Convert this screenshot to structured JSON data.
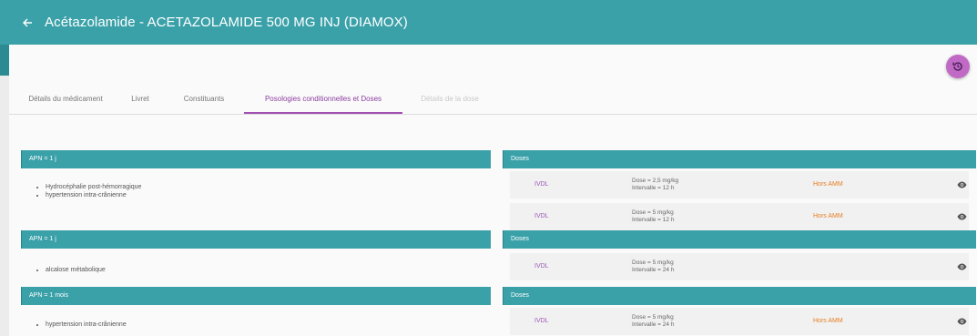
{
  "header": {
    "title": "Acétazolamide - ACETAZOLAMIDE 500 MG INJ (DIAMOX)",
    "back_icon": "arrow-left-icon",
    "color": "#3ba1a9"
  },
  "history_button": {
    "icon": "history-icon",
    "color": "#c06ac6"
  },
  "tabs": [
    {
      "label": "Détails du médicament",
      "state": "normal"
    },
    {
      "label": "Livret",
      "state": "normal"
    },
    {
      "label": "Constituants",
      "state": "normal"
    },
    {
      "label": "Posologies conditionnelles et Doses",
      "state": "active"
    },
    {
      "label": "Détails de la dose",
      "state": "disabled"
    }
  ],
  "sections": [
    {
      "condition": "APN = 1 j",
      "indications": [
        "Hydrocéphalie post-hémorragique",
        "hypertension intra-crânienne"
      ],
      "doses_title": "Doses",
      "doses": [
        {
          "route": "IVDL",
          "dose": "Dose = 2,5 mg/kg",
          "interval": "Intervalle = 12 h",
          "warning": "Hors AMM"
        },
        {
          "route": "IVDL",
          "dose": "Dose = 5 mg/kg",
          "interval": "Intervalle = 12 h",
          "warning": "Hors AMM"
        }
      ]
    },
    {
      "condition": "APN = 1 j",
      "indications": [
        "alcalose métabolique"
      ],
      "doses_title": "Doses",
      "doses": [
        {
          "route": "IVDL",
          "dose": "Dose = 5 mg/kg",
          "interval": "Intervalle = 24 h",
          "warning": ""
        }
      ]
    },
    {
      "condition": "APN = 1 mois",
      "indications": [
        "hypertension intra-crânienne"
      ],
      "doses_title": "Doses",
      "doses": [
        {
          "route": "IVDL",
          "dose": "Dose = 5 mg/kg",
          "interval": "Intervalle = 24 h",
          "warning": "Hors AMM"
        }
      ]
    }
  ],
  "colors": {
    "accent": "#3ba1a9",
    "route": "#9b59b6",
    "warning": "#e67e22",
    "active_tab": "#a14fb1"
  }
}
